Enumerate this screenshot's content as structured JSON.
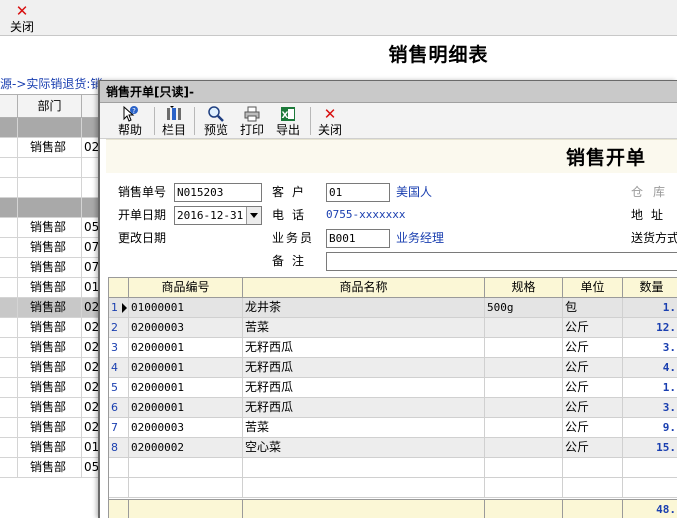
{
  "background": {
    "toolbar": {
      "close_label": "关闭"
    },
    "title": "销售明细表",
    "path": "源->实际销退货:销",
    "grid": {
      "headers": [
        "",
        "部门",
        ""
      ],
      "rows": [
        {
          "dept": "",
          "code": "",
          "type": "group"
        },
        {
          "dept": "销售部",
          "code": "02",
          "type": "row"
        },
        {
          "dept": "",
          "code": "",
          "type": "row"
        },
        {
          "dept": "",
          "code": "",
          "type": "row"
        },
        {
          "dept": "",
          "code": "",
          "type": "group"
        },
        {
          "dept": "销售部",
          "code": "05",
          "type": "row"
        },
        {
          "dept": "销售部",
          "code": "07",
          "type": "row"
        },
        {
          "dept": "销售部",
          "code": "07",
          "type": "row"
        },
        {
          "dept": "销售部",
          "code": "01",
          "type": "row"
        },
        {
          "dept": "销售部",
          "code": "02",
          "type": "sel"
        },
        {
          "dept": "销售部",
          "code": "02",
          "type": "row"
        },
        {
          "dept": "销售部",
          "code": "02",
          "type": "row"
        },
        {
          "dept": "销售部",
          "code": "02",
          "type": "row"
        },
        {
          "dept": "销售部",
          "code": "02",
          "type": "row"
        },
        {
          "dept": "销售部",
          "code": "02",
          "type": "row"
        },
        {
          "dept": "销售部",
          "code": "02",
          "type": "row"
        },
        {
          "dept": "销售部",
          "code": "01",
          "type": "row"
        },
        {
          "dept": "销售部",
          "code": "05",
          "type": "row"
        }
      ]
    }
  },
  "dialog": {
    "title": "销售开单[只读]-",
    "toolbar": {
      "help": "帮助",
      "columns": "栏目",
      "preview": "预览",
      "print": "打印",
      "export": "导出",
      "close": "关闭"
    },
    "heading": "销售开单",
    "form": {
      "order_no_label": "销售单号",
      "order_no": "N015203",
      "customer_label": "客户",
      "customer_code": "01",
      "customer_name": "美国人",
      "warehouse_label": "仓库",
      "date_label": "开单日期",
      "date": "2016-12-31",
      "phone_label": "电话",
      "phone": "0755-xxxxxxx",
      "address_label": "地址",
      "modified_label": "更改日期",
      "salesman_label": "业务员",
      "salesman_code": "B001",
      "salesman_name": "业务经理",
      "delivery_label": "送货方式",
      "remark_label": "备注",
      "remark": ""
    },
    "grid": {
      "headers": {
        "code": "商品编号",
        "name": "商品名称",
        "spec": "规格",
        "unit": "单位",
        "qty": "数量"
      },
      "rows": [
        {
          "no": "1",
          "code": "01000001",
          "name": "龙井茶",
          "spec": "500g",
          "unit": "包",
          "qty": "1."
        },
        {
          "no": "2",
          "code": "02000003",
          "name": "苦菜",
          "spec": "",
          "unit": "公斤",
          "qty": "12."
        },
        {
          "no": "3",
          "code": "02000001",
          "name": "无籽西瓜",
          "spec": "",
          "unit": "公斤",
          "qty": "3."
        },
        {
          "no": "4",
          "code": "02000001",
          "name": "无籽西瓜",
          "spec": "",
          "unit": "公斤",
          "qty": "4."
        },
        {
          "no": "5",
          "code": "02000001",
          "name": "无籽西瓜",
          "spec": "",
          "unit": "公斤",
          "qty": "1."
        },
        {
          "no": "6",
          "code": "02000001",
          "name": "无籽西瓜",
          "spec": "",
          "unit": "公斤",
          "qty": "3."
        },
        {
          "no": "7",
          "code": "02000003",
          "name": "苦菜",
          "spec": "",
          "unit": "公斤",
          "qty": "9."
        },
        {
          "no": "8",
          "code": "02000002",
          "name": "空心菜",
          "spec": "",
          "unit": "公斤",
          "qty": "15."
        }
      ],
      "total_qty": "48."
    }
  }
}
